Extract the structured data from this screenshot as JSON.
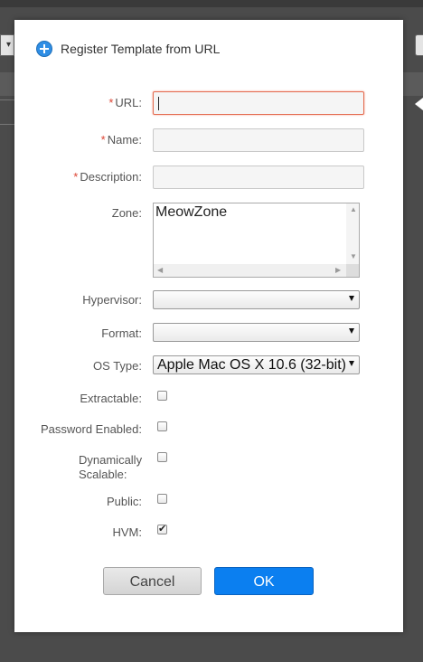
{
  "background": {
    "left_select_arrow": "▾"
  },
  "dialog": {
    "title": "Register Template from URL",
    "title_icon": "plus-circle-icon",
    "accent_color": "#2f8ee5"
  },
  "form": {
    "url": {
      "label": "URL:",
      "required": "*",
      "value": ""
    },
    "name": {
      "label": "Name:",
      "required": "*",
      "value": ""
    },
    "description": {
      "label": "Description:",
      "required": "*",
      "value": ""
    },
    "zone": {
      "label": "Zone:",
      "options": [
        "MeowZone"
      ]
    },
    "hypervisor": {
      "label": "Hypervisor:",
      "selected": ""
    },
    "format": {
      "label": "Format:",
      "selected": ""
    },
    "os_type": {
      "label": "OS Type:",
      "selected": "Apple Mac OS X 10.6 (32-bit)"
    },
    "extractable": {
      "label": "Extractable:",
      "checked": false
    },
    "password_enabled": {
      "label": "Password Enabled:",
      "checked": false
    },
    "dynamically_scalable": {
      "label_line1": "Dynamically",
      "label_line2": "Scalable:",
      "checked": false
    },
    "public": {
      "label": "Public:",
      "checked": false
    },
    "hvm": {
      "label": "HVM:",
      "checked": true,
      "mark": "✔"
    }
  },
  "buttons": {
    "cancel": "Cancel",
    "ok": "OK",
    "ok_color": "#0b7ff0"
  }
}
